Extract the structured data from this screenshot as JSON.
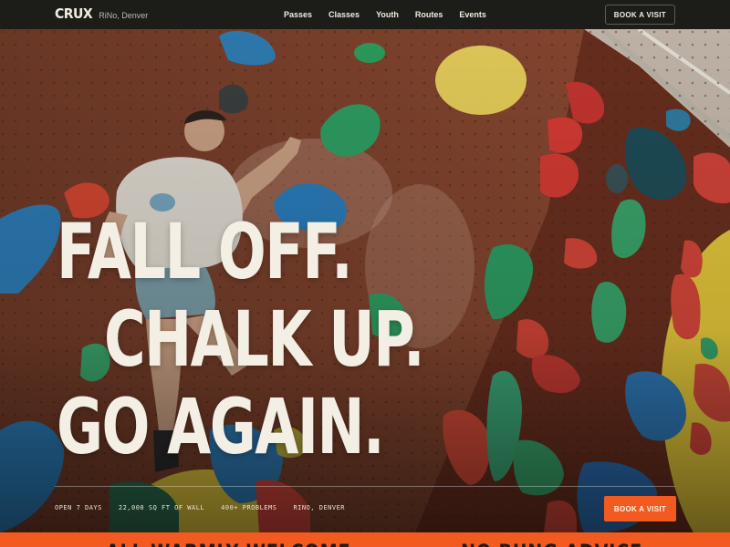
{
  "nav": {
    "logo": "CRUX",
    "location": "RiNo, Denver",
    "links": [
      "Passes",
      "Classes",
      "Youth",
      "Routes",
      "Events"
    ],
    "cta_label": "BOOK A VISIT"
  },
  "hero": {
    "headline": [
      "FALL OFF.",
      "CHALK UP.",
      "GO AGAIN."
    ],
    "stats": [
      "OPEN 7 DAYS",
      "22,000 SQ FT OF WALL",
      "400+ PROBLEMS",
      "RINO, DENVER"
    ],
    "cta_label": "BOOK A VISIT"
  },
  "ticker": {
    "items": [
      "ALL WARMLY WELCOME",
      "NO BUNG ADVICE"
    ]
  },
  "colors": {
    "accent": "#f25a1f",
    "nav_bg": "#1c1d18",
    "text_light": "#f1ece1"
  }
}
